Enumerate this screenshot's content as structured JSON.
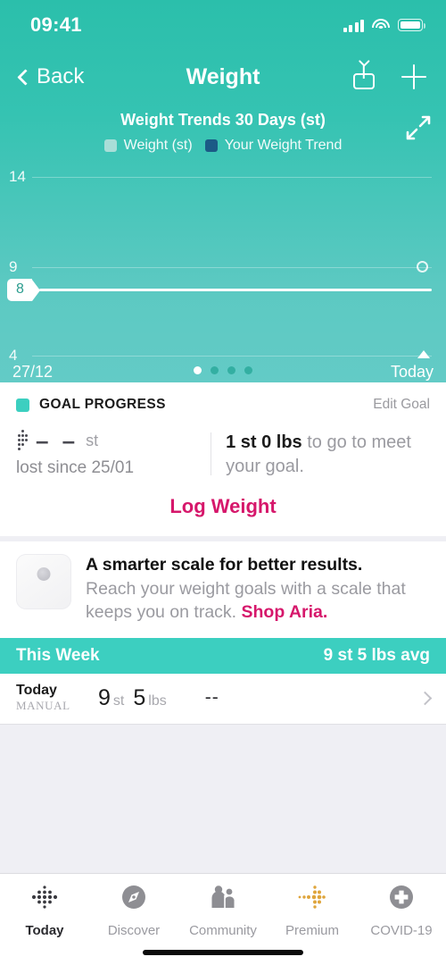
{
  "status_bar": {
    "time": "09:41",
    "signal_icon": "cellular-signal-icon",
    "wifi_icon": "wifi-icon",
    "battery_icon": "battery-icon"
  },
  "nav": {
    "back_label": "Back",
    "back_icon": "chevron-left-icon",
    "title": "Weight",
    "share_icon": "share-icon",
    "add_icon": "plus-icon"
  },
  "chart": {
    "title": "Weight Trends 30 Days (st)",
    "expand_icon": "expand-icon",
    "legend": [
      {
        "label": "Weight (st)",
        "color": "#a9ded8"
      },
      {
        "label": "Your Weight Trend",
        "color": "#1b5a86"
      }
    ],
    "x_start": "27/12",
    "x_end": "Today",
    "badge_value": "8",
    "page_dots": 4,
    "active_dot": 0
  },
  "chart_data": {
    "type": "line",
    "title": "Weight Trends 30 Days (st)",
    "xlabel": "",
    "ylabel": "st",
    "ylim": [
      4,
      14
    ],
    "yticks": [
      14,
      9,
      4
    ],
    "x": [
      "27/12",
      "Today"
    ],
    "series": [
      {
        "name": "Weight (st)",
        "color": "#a9ded8",
        "values": [
          9.36
        ]
      },
      {
        "name": "Your Weight Trend",
        "color": "#ffffff",
        "values": [
          8.6,
          8.6
        ]
      }
    ],
    "annotations": [
      {
        "text": "8",
        "type": "axis-badge",
        "value": 8.6
      },
      {
        "text": "Today",
        "type": "x-axis-caret"
      }
    ],
    "grid": true,
    "legend_position": "top"
  },
  "goal": {
    "section_icon": "goal-square-icon",
    "section_title": "GOAL PROGRESS",
    "edit_label": "Edit Goal",
    "lost_icon": "fitbit-dots-icon",
    "lost_value": "– –",
    "lost_unit": "st",
    "lost_since": "lost since 25/01",
    "to_go_value": "1 st 0 lbs",
    "to_go_text": " to go to meet your goal.",
    "log_weight_label": "Log Weight"
  },
  "promo": {
    "image_icon": "aria-scale-image",
    "title": "A smarter scale for better results.",
    "description": "Reach your weight goals with a scale that keeps you on track. ",
    "link_label": "Shop Aria."
  },
  "week": {
    "label": "This Week",
    "average": "9 st 5 lbs avg"
  },
  "entry": {
    "day": "Today",
    "source": "MANUAL",
    "stone_value": "9",
    "stone_unit": "st",
    "pound_value": "5",
    "pound_unit": "lbs",
    "secondary": "--",
    "chevron_icon": "chevron-right-icon"
  },
  "tabs": [
    {
      "label": "Today",
      "icon": "fitbit-dots-icon",
      "active": true
    },
    {
      "label": "Discover",
      "icon": "compass-icon",
      "active": false
    },
    {
      "label": "Community",
      "icon": "people-icon",
      "active": false
    },
    {
      "label": "Premium",
      "icon": "premium-dots-icon",
      "active": false
    },
    {
      "label": "COVID-19",
      "icon": "medical-cross-icon",
      "active": false
    }
  ],
  "colors": {
    "teal": "#3ccfc0",
    "teal_dark": "#2bbfab",
    "pink": "#d6176b",
    "gold": "#dfa53c",
    "grey": "#8e8e93"
  }
}
